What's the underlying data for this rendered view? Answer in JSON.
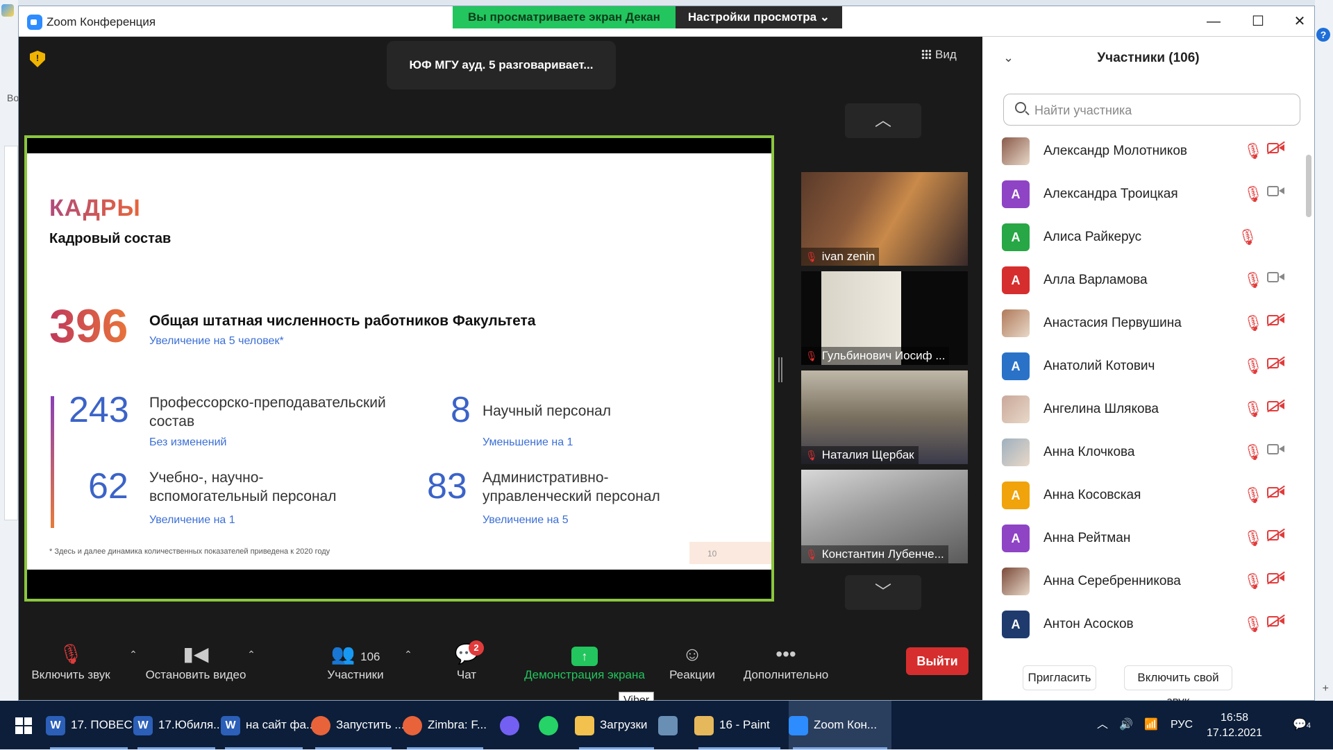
{
  "desktop": {
    "left_text": "Во"
  },
  "window": {
    "title": "Zoom Конференция",
    "minimize": "—",
    "maximize": "☐",
    "close": "✕"
  },
  "share_banner": {
    "status": "Вы просматриваете экран Декан",
    "options": "Настройки просмотра ⌄"
  },
  "meeting": {
    "speaker": "ЮФ МГУ ауд. 5 разговаривает...",
    "view_label": "Вид"
  },
  "slide": {
    "heading": "КАДРЫ",
    "subheading": "Кадровый состав",
    "total": {
      "value": "396",
      "label": "Общая штатная численность работников Факультета",
      "change": "Увеличение на 5 человек*"
    },
    "stats": [
      {
        "value": "243",
        "label_line1": "Профессорско-преподавательский",
        "label_line2": "состав",
        "change": "Без изменений"
      },
      {
        "value": "8",
        "label_line1": "Научный персонал",
        "label_line2": "",
        "change": "Уменьшение на 1"
      },
      {
        "value": "62",
        "label_line1": "Учебно-, научно-",
        "label_line2": "вспомогательный персонал",
        "change": "Увеличение на 1"
      },
      {
        "value": "83",
        "label_line1": "Административно-",
        "label_line2": "управленческий персонал",
        "change": "Увеличение на 5"
      }
    ],
    "footnote": "* Здесь и далее динамика количественных показателей приведена к 2020 году",
    "page_number": "10"
  },
  "thumbnails": [
    {
      "name": "ivan zenin"
    },
    {
      "name": "Гульбинович Иосиф ..."
    },
    {
      "name": "Наталия Щербак"
    },
    {
      "name": "Константин Лубенче..."
    }
  ],
  "toolbar": {
    "unmute": "Включить звук",
    "stop_video": "Остановить видео",
    "participants": "Участники",
    "participants_count": "106",
    "chat": "Чат",
    "chat_badge": "2",
    "share": "Демонстрация экрана",
    "reactions": "Реакции",
    "more": "Дополнительно",
    "leave": "Выйти"
  },
  "tooltip": "Viber",
  "panel": {
    "title": "Участники (106)",
    "search_placeholder": "Найти участника",
    "invite": "Пригласить",
    "unmute_me": "Включить свой звук",
    "participants": [
      {
        "name": "Александр Молотников",
        "initial": "",
        "color": "#8a5a4a",
        "photo": true,
        "mic": true,
        "cam": "off"
      },
      {
        "name": "Александра Троицкая",
        "initial": "А",
        "color": "#8e44c4",
        "photo": false,
        "mic": true,
        "cam": "on"
      },
      {
        "name": "Алиса Райкерус",
        "initial": "А",
        "color": "#27a745",
        "photo": false,
        "mic": false,
        "cam": "off"
      },
      {
        "name": "Алла Варламова",
        "initial": "А",
        "color": "#d62e2e",
        "photo": false,
        "mic": true,
        "cam": "on"
      },
      {
        "name": "Анастасия Первушина",
        "initial": "",
        "color": "#b07a5a",
        "photo": true,
        "mic": true,
        "cam": "off"
      },
      {
        "name": "Анатолий Котович",
        "initial": "А",
        "color": "#2a72c8",
        "photo": false,
        "mic": true,
        "cam": "off"
      },
      {
        "name": "Ангелина Шлякова",
        "initial": "",
        "color": "#c9a89a",
        "photo": true,
        "mic": true,
        "cam": "off"
      },
      {
        "name": "Анна Клочкова",
        "initial": "",
        "color": "#9fb0bf",
        "photo": true,
        "mic": true,
        "cam": "on"
      },
      {
        "name": "Анна Косовская",
        "initial": "А",
        "color": "#f0a30a",
        "photo": false,
        "mic": true,
        "cam": "off"
      },
      {
        "name": "Анна Рейтман",
        "initial": "А",
        "color": "#8e44c4",
        "photo": false,
        "mic": true,
        "cam": "off"
      },
      {
        "name": "Анна Серебренникова",
        "initial": "",
        "color": "#7a4a3a",
        "photo": true,
        "mic": true,
        "cam": "off"
      },
      {
        "name": "Антон Асосков",
        "initial": "А",
        "color": "#1f3b6e",
        "photo": false,
        "mic": true,
        "cam": "off"
      }
    ]
  },
  "taskbar": {
    "items": [
      {
        "label": "17. ПОВЕС...",
        "icon": "W",
        "color": "#2b5fb8"
      },
      {
        "label": "17.Юбиля...",
        "icon": "W",
        "color": "#2b5fb8"
      },
      {
        "label": "на сайт фа...",
        "icon": "W",
        "color": "#2b5fb8"
      },
      {
        "label": "Запустить ...",
        "icon": "",
        "color": "#e8633a"
      },
      {
        "label": "Zimbra: F...",
        "icon": "",
        "color": "#e8633a"
      },
      {
        "label": "",
        "icon": "",
        "color": "#7360f2"
      },
      {
        "label": "",
        "icon": "",
        "color": "#25d366"
      },
      {
        "label": "Загрузки",
        "icon": "",
        "color": "#f2c14e"
      },
      {
        "label": "",
        "icon": "",
        "color": "#6a8fb5"
      },
      {
        "label": "16 - Paint",
        "icon": "",
        "color": "#e6b85c"
      },
      {
        "label": "Zoom Кон...",
        "icon": "",
        "color": "#2d8cff"
      }
    ],
    "language": "РУС",
    "time": "16:58",
    "date": "17.12.2021",
    "notifications": "4"
  }
}
